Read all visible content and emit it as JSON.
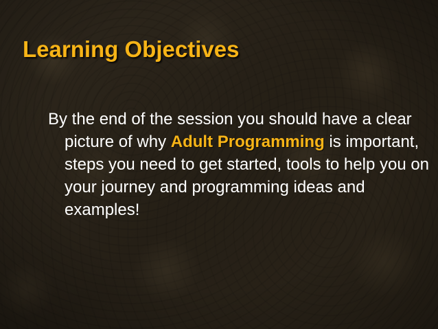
{
  "slide": {
    "title": "Learning Objectives",
    "body": {
      "part1": "By the end of the session you should have a clear picture of why ",
      "highlight": "Adult Programming",
      "part2": " is important, steps you need to get started, tools to help you on your journey and programming ideas and examples!"
    },
    "colors": {
      "accent": "#f7b417",
      "text": "#ffffff",
      "background": "#2a241a"
    }
  }
}
